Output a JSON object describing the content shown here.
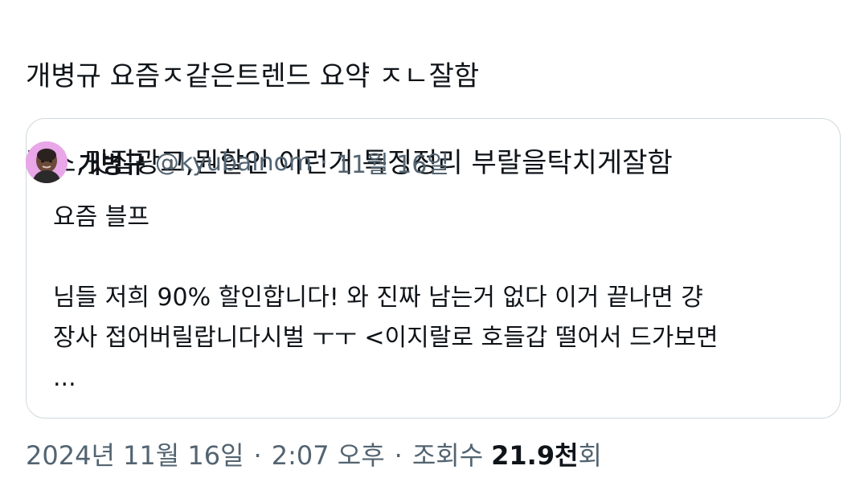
{
  "post": {
    "line1": "개병규 요즘ㅈ같은트렌드 요약 ㅈㄴ잘함",
    "line2": "릴스,맛집광고,뭔할인 이런거 특징정리 부랄을탁치게잘함"
  },
  "quote": {
    "author_name": "개병규",
    "author_handle": "@kyubalnom",
    "separator": "·",
    "date": "11월 16일",
    "body_line1": "요즘 블프",
    "body_line2": "님들 저희 90% 할인합니다! 와 진짜 남는거 없다 이거 끝나면 걍",
    "body_line3": "장사 접어버릴랍니다시벌 ㅜㅜ <이지랄로 호들갑 떨어서 드가보면",
    "body_line4": "..."
  },
  "meta": {
    "date": "2024년 11월 16일",
    "separator": "·",
    "time": "2:07 오후",
    "views_label": "조회수",
    "views_count": "21.9천",
    "views_suffix": "회"
  },
  "colors": {
    "text": "#0f1419",
    "secondary": "#536471",
    "border": "#cfd9de",
    "avatar_bg": "#e9a6e8"
  }
}
